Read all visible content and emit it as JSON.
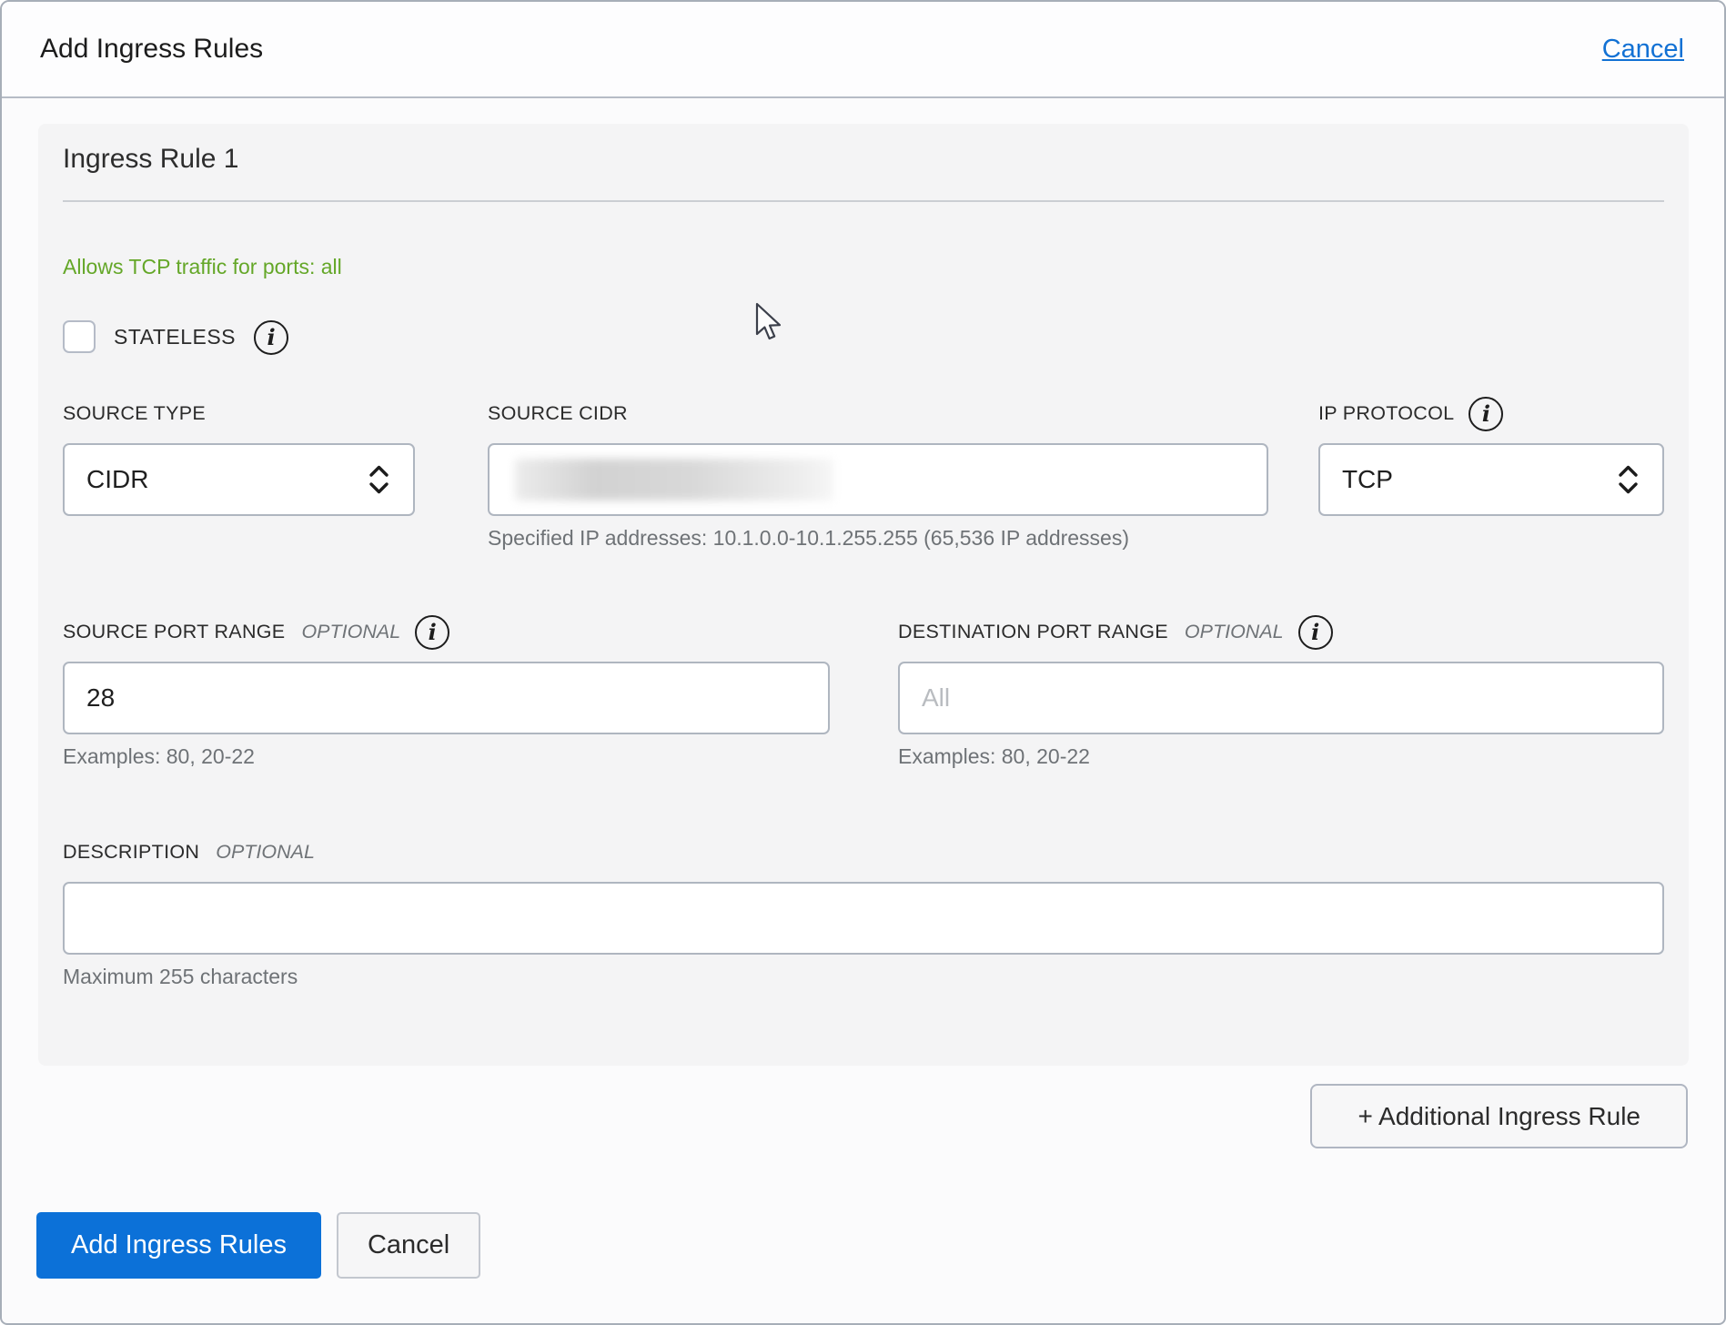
{
  "dialog": {
    "title": "Add Ingress Rules",
    "cancel_link": "Cancel"
  },
  "rule": {
    "title": "Ingress Rule 1",
    "traffic_note": "Allows TCP traffic for ports: all",
    "stateless": {
      "label": "STATELESS",
      "checked": false
    },
    "fields": {
      "source_type": {
        "label": "SOURCE TYPE",
        "value": "CIDR"
      },
      "source_cidr": {
        "label": "SOURCE CIDR",
        "value": "",
        "value_redacted": true,
        "helper": "Specified IP addresses: 10.1.0.0-10.1.255.255 (65,536 IP addresses)"
      },
      "ip_protocol": {
        "label": "IP PROTOCOL",
        "value": "TCP"
      },
      "source_port_range": {
        "label": "SOURCE PORT RANGE",
        "optional_label": "OPTIONAL",
        "value": "28",
        "helper": "Examples: 80, 20-22"
      },
      "destination_port_range": {
        "label": "DESTINATION PORT RANGE",
        "optional_label": "OPTIONAL",
        "value": "",
        "placeholder": "All",
        "helper": "Examples: 80, 20-22"
      },
      "description": {
        "label": "DESCRIPTION",
        "optional_label": "OPTIONAL",
        "value": "",
        "helper": "Maximum 255 characters"
      }
    }
  },
  "buttons": {
    "additional_rule": "+ Additional Ingress Rule",
    "submit": "Add Ingress Rules",
    "cancel": "Cancel"
  },
  "icons": {
    "info": "i",
    "select_chevrons": "chevron-up-down"
  },
  "colors": {
    "accent_blue": "#0c71d8",
    "link_blue": "#1271d4",
    "success_green": "#64a728",
    "panel_bg": "#f4f4f5",
    "input_border": "#afb6c0"
  }
}
